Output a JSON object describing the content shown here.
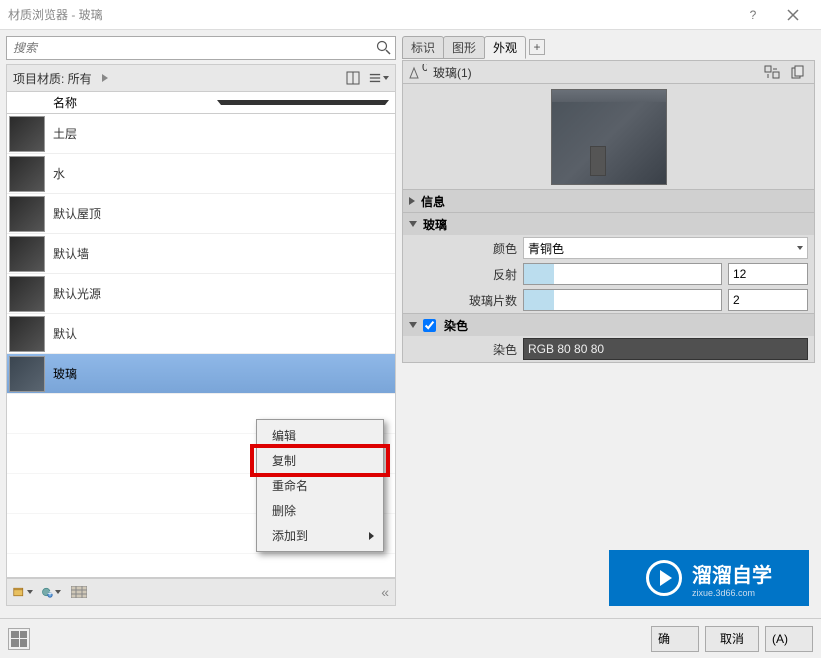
{
  "window": {
    "title": "材质浏览器 - 玻璃"
  },
  "search": {
    "placeholder": "搜索"
  },
  "filter": {
    "label": "项目材质: 所有"
  },
  "list": {
    "header": "名称",
    "items": [
      {
        "name": "土层"
      },
      {
        "name": "水"
      },
      {
        "name": "默认屋顶"
      },
      {
        "name": "默认墙"
      },
      {
        "name": "默认光源"
      },
      {
        "name": "默认"
      },
      {
        "name": "玻璃"
      }
    ]
  },
  "context_menu": {
    "items": [
      "编辑",
      "复制",
      "重命名",
      "删除",
      "添加到"
    ]
  },
  "tabs": {
    "items": [
      "标识",
      "图形",
      "外观"
    ],
    "add": "+"
  },
  "asset": {
    "label": "玻璃(1)",
    "badge": "0"
  },
  "sections": {
    "info": "信息",
    "main": {
      "title": "玻璃",
      "color_label": "颜色",
      "color_value": "青铜色",
      "reflect_label": "反射",
      "reflect_value": "12",
      "sheets_label": "玻璃片数",
      "sheets_value": "2"
    },
    "tint": {
      "title": "染色",
      "label": "染色",
      "value": "RGB 80 80 80"
    }
  },
  "watermark": {
    "big": "溜溜自学",
    "small": "zixue.3d66.com"
  },
  "footer": {
    "ok": "确",
    "cancel": "取消",
    "apply": "(A)"
  }
}
